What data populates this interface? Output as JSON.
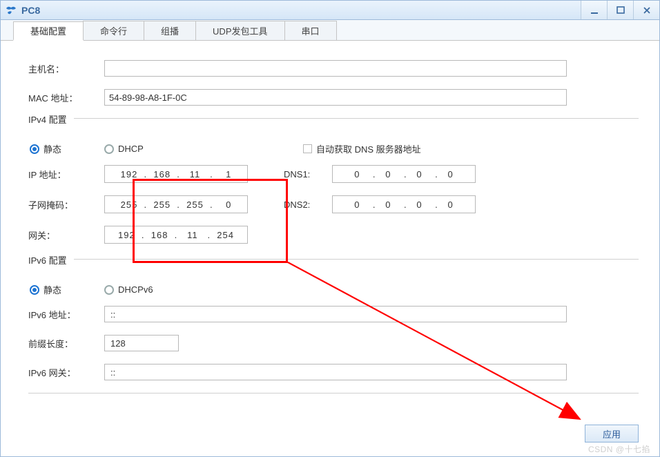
{
  "window": {
    "title": "PC8"
  },
  "tabs": {
    "basic": "基础配置",
    "cli": "命令行",
    "mcast": "组播",
    "udp": "UDP发包工具",
    "serial": "串口"
  },
  "labels": {
    "hostname": "主机名：",
    "mac": "MAC 地址：",
    "ipv4_cfg": "IPv4 配置",
    "static": "静态",
    "dhcp": "DHCP",
    "auto_dns": "自动获取 DNS 服务器地址",
    "ip": "IP 地址：",
    "mask": "子网掩码：",
    "gw": "网关：",
    "dns1": "DNS1:",
    "dns2": "DNS2:",
    "ipv6_cfg": "IPv6 配置",
    "dhcpv6": "DHCPv6",
    "ipv6_addr": "IPv6 地址：",
    "prefix": "前缀长度：",
    "ipv6_gw": "IPv6 网关：",
    "apply": "应用"
  },
  "values": {
    "hostname": "",
    "mac": "54-89-98-A8-1F-0C",
    "ip": "192  .  168  .   11   .    1",
    "mask": "255  .  255  .  255  .    0",
    "gw": "192  .  168  .   11   .  254",
    "dns1": "0    .   0    .   0    .   0",
    "dns2": "0    .   0    .   0    .   0",
    "ipv6_addr": "::",
    "prefix": "128",
    "ipv6_gw": "::",
    "ipv4_mode": "static",
    "ipv6_mode": "static",
    "auto_dns": false
  },
  "watermark": "CSDN @十七掐"
}
